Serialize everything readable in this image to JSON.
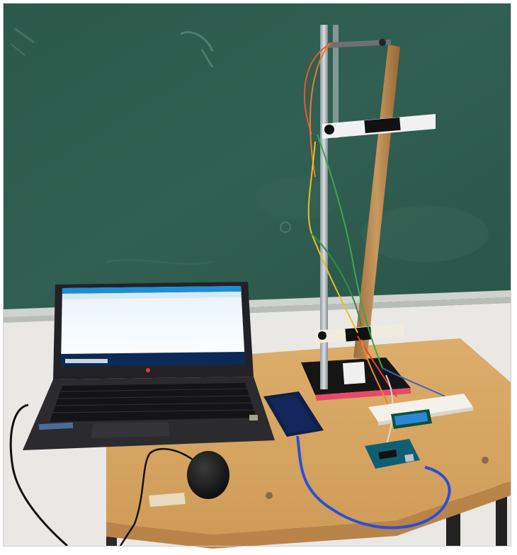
{
  "photo": {
    "subject": "",
    "colors": {
      "chalkboard": "#2f5a4c",
      "wall": "#e9e8e6",
      "table_top": "#d6a35d",
      "laptop": "#1f1f22",
      "phone": "#0f1f4a",
      "usb_cable": "#2d4fd1",
      "pvc_pipe": "#b98a50",
      "lcd": "#2b87d6",
      "arduino": "#0f5f73"
    }
  }
}
